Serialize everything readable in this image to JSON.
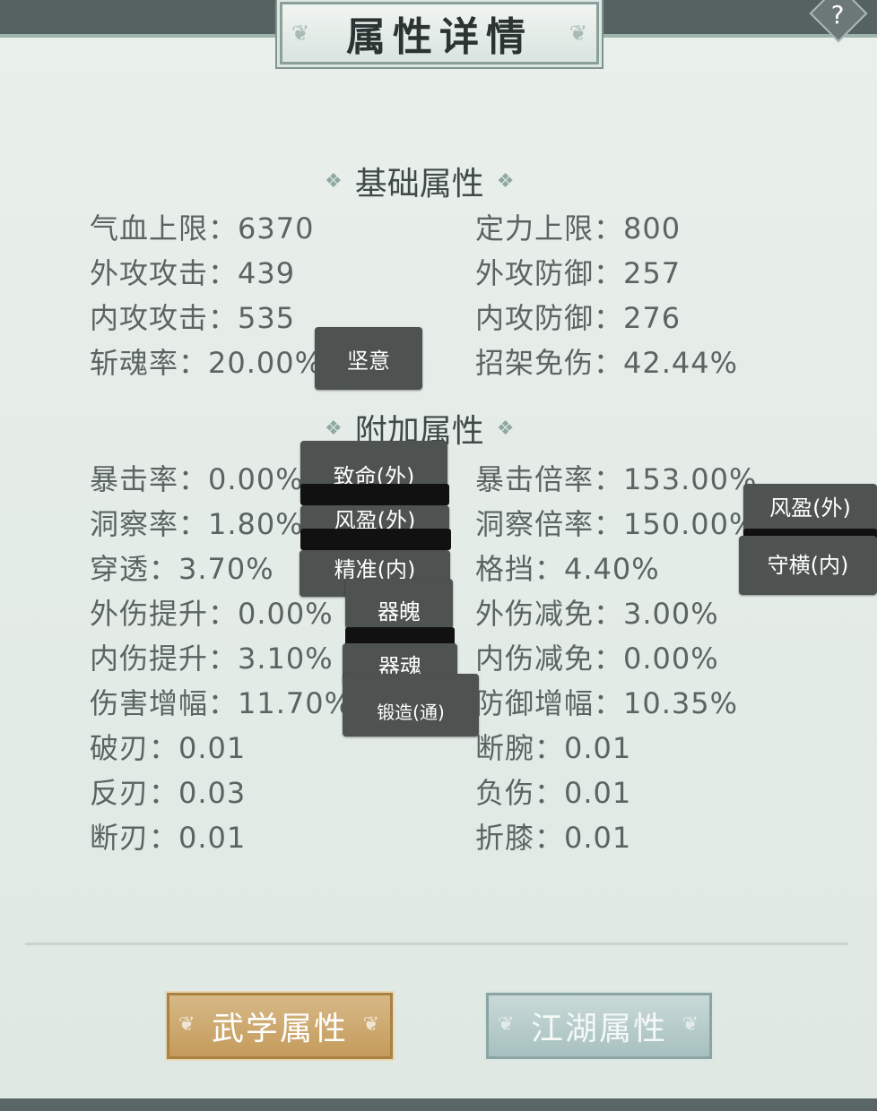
{
  "header": {
    "title": "属性详情",
    "help_symbol": "?"
  },
  "sections": {
    "basic": {
      "title": "基础属性"
    },
    "extra": {
      "title": "附加属性"
    }
  },
  "stats": {
    "qixue": "气血上限：6370",
    "dingli": "定力上限：800",
    "waigong_atk": "外攻攻击：439",
    "waigong_def": "外攻防御：257",
    "neigong_atk": "内攻攻击：535",
    "neigong_def": "内攻防御：276",
    "zhanhun": "斩魂率：20.00%",
    "zhaojia": "招架免伤：42.44%",
    "baoji": "暴击率：0.00%",
    "baoji_beilv": "暴击倍率：153.00%",
    "dongcha": "洞察率：1.80%",
    "dongcha_beilv": "洞察倍率：150.00%",
    "chuantou": "穿透：3.70%",
    "gedang": "格挡：4.40%",
    "waishang_up": "外伤提升：0.00%",
    "waishang_down": "外伤减免：3.00%",
    "neishang_up": "内伤提升：3.10%",
    "neishang_down": "内伤减免：0.00%",
    "shanghai_up": "伤害增幅：11.70%",
    "fangyu_up": "防御增幅：10.35%",
    "poren": "破刃：0.01",
    "duanwan": "断腕：0.01",
    "fanren": "反刃：0.03",
    "fushang": "负伤：0.01",
    "duanren": "断刃：0.01",
    "zhexi": "折膝：0.01"
  },
  "tags": {
    "jianyi": "坚意",
    "zhiming_wai": "致命(外)",
    "fengying_wai": "风盈(外)",
    "jingzhun_nei": "精准(内)",
    "qipo": "器魄",
    "qihun": "器魂",
    "duanzao": "锻造(通)",
    "fengying_wai_right": "风盈(外)",
    "shouheng_nei": "守横(内)"
  },
  "buttons": {
    "wuxue": "武学属性",
    "jianghu": "江湖属性"
  },
  "colors": {
    "wuxue_btn": "#c9a368",
    "jianghu_btn": "#b2cac8",
    "tag_bg": "#4e5251"
  }
}
